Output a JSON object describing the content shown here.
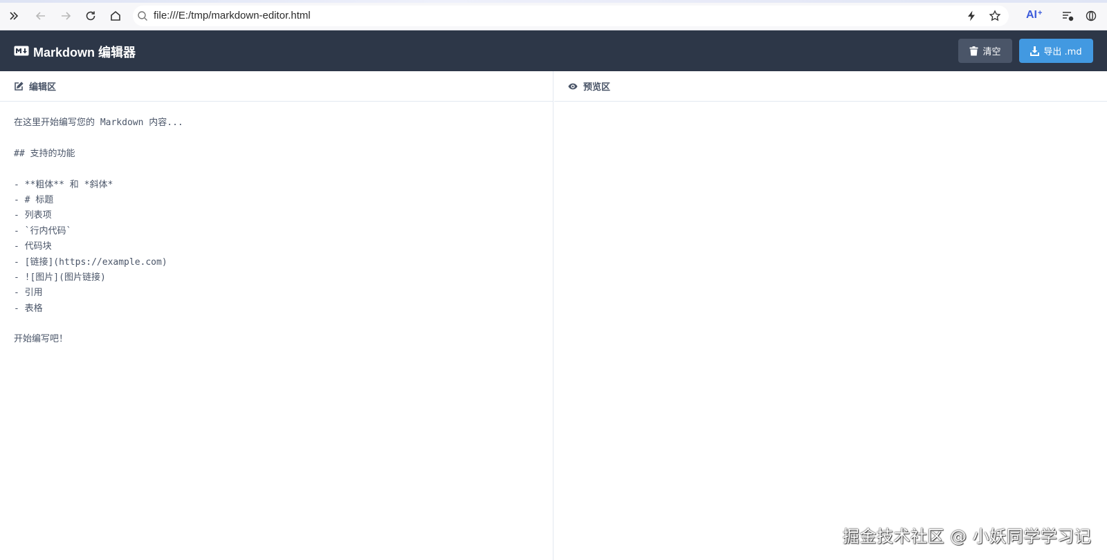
{
  "browser": {
    "url": "file:///E:/tmp/markdown-editor.html",
    "ai_label": "AI",
    "ai_plus": "+"
  },
  "app": {
    "title": "Markdown 编辑器",
    "clear_label": "清空",
    "export_label": "导出 .md"
  },
  "editor": {
    "header": "编辑区",
    "lines": [
      "在这里开始编写您的 Markdown 内容...",
      "",
      "## 支持的功能",
      "",
      "- **粗体** 和 *斜体*",
      "- # 标题",
      "- 列表项",
      "- `行内代码`",
      "- 代码块",
      "- [链接](https://example.com)",
      "- ![图片](图片链接)",
      "- 引用",
      "- 表格",
      "",
      "开始编写吧！"
    ]
  },
  "preview": {
    "header": "预览区"
  },
  "watermark": "掘金技术社区 @ 小妖同学学习记",
  "colors": {
    "header_bg": "#2d3748",
    "clear_btn": "#4a5568",
    "export_btn": "#4299e1"
  }
}
